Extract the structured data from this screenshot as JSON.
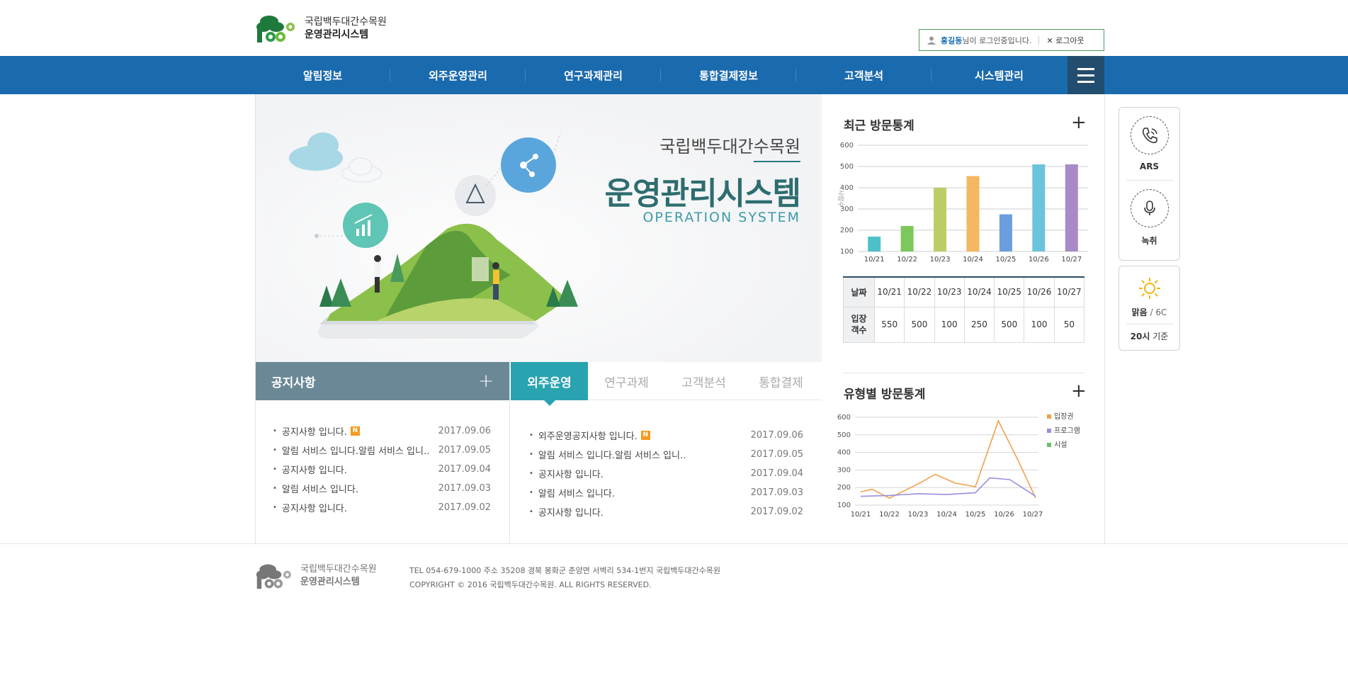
{
  "header": {
    "logo_line1": "국립백두대간수목원",
    "logo_line2": "운영관리시스템",
    "login_user": "홍길동",
    "login_suffix": "님이 로그인중입니다.",
    "logout": "로그아웃"
  },
  "nav": {
    "items": [
      "알림정보",
      "외주운영관리",
      "연구과제관리",
      "통합결제정보",
      "고객분석",
      "시스템관리"
    ]
  },
  "hero": {
    "title1": "국립백두대간수목원",
    "title2": "운영관리시스템",
    "title3": "OPERATION SYSTEM"
  },
  "notice": {
    "title": "공지사항",
    "items": [
      {
        "text": "공지사항 입니다.",
        "date": "2017.09.06",
        "new": true
      },
      {
        "text": "알림 서비스 입니다.알림 서비스 입니…",
        "date": "2017.09.05",
        "new": false
      },
      {
        "text": "공지사항 입니다.",
        "date": "2017.09.04",
        "new": false
      },
      {
        "text": "알림 서비스 입니다.",
        "date": "2017.09.03",
        "new": false
      },
      {
        "text": "공지사항 입니다.",
        "date": "2017.09.02",
        "new": false
      }
    ]
  },
  "tabs": {
    "labels": [
      "외주운영",
      "연구과제",
      "고객분석",
      "통합결제"
    ],
    "items": [
      {
        "text": "외주운영공지사항 입니다.",
        "date": "2017.09.06",
        "new": true
      },
      {
        "text": "알림 서비스 입니다.알림 서비스 입니…",
        "date": "2017.09.05",
        "new": false
      },
      {
        "text": "공지사항 입니다.",
        "date": "2017.09.04",
        "new": false
      },
      {
        "text": "알림 서비스 입니다.",
        "date": "2017.09.03",
        "new": false
      },
      {
        "text": "공지사항 입니다.",
        "date": "2017.09.02",
        "new": false
      }
    ]
  },
  "badge_new": "N",
  "visit_stats": {
    "title": "최근 방문통계",
    "ylabel": "사람수",
    "table_head_date": "날짜",
    "table_head_count": "입장객수",
    "counts": [
      "550",
      "500",
      "100",
      "250",
      "500",
      "100",
      "50"
    ]
  },
  "type_stats": {
    "title": "유형별 방문통계"
  },
  "chart_data": [
    {
      "type": "bar",
      "title": "최근 방문통계",
      "ylabel": "사람수",
      "categories": [
        "10/21",
        "10/22",
        "10/23",
        "10/24",
        "10/25",
        "10/26",
        "10/27"
      ],
      "values": [
        170,
        220,
        400,
        455,
        275,
        510,
        510
      ],
      "colors": [
        "#4fc0c8",
        "#7cc85a",
        "#bccd68",
        "#f5b75f",
        "#6a9ee0",
        "#6cc4dc",
        "#a98ac8"
      ],
      "ylim": [
        100,
        600
      ],
      "yticks": [
        100,
        200,
        300,
        400,
        500,
        600
      ]
    },
    {
      "type": "line",
      "title": "유형별 방문통계",
      "categories": [
        "10/21",
        "10/22",
        "10/23",
        "10/24",
        "10/25",
        "10/26",
        "10/27"
      ],
      "x": [
        0,
        0.5,
        1.5,
        2,
        2.5,
        3.5,
        4.5,
        5.0,
        5.5,
        6.0,
        6.5,
        7
      ],
      "series": [
        {
          "name": "입장권",
          "color": "#f0a04b",
          "points": [
            [
              0,
              175
            ],
            [
              0.4,
              190
            ],
            [
              1,
              140
            ],
            [
              2,
              220
            ],
            [
              2.6,
              275
            ],
            [
              3.3,
              225
            ],
            [
              4,
              205
            ],
            [
              4.8,
              580
            ],
            [
              5.5,
              350
            ],
            [
              6.1,
              140
            ]
          ]
        },
        {
          "name": "프로그램",
          "color": "#9b8fdc",
          "points": [
            [
              0,
              150
            ],
            [
              1,
              155
            ],
            [
              2,
              165
            ],
            [
              3,
              160
            ],
            [
              4,
              170
            ],
            [
              4.5,
              255
            ],
            [
              5.2,
              245
            ],
            [
              6.1,
              150
            ]
          ]
        },
        {
          "name": "시설",
          "color": "#6cc06c",
          "points": []
        }
      ],
      "ylim": [
        100,
        600
      ],
      "yticks": [
        100,
        200,
        300,
        400,
        500,
        600
      ]
    }
  ],
  "side": {
    "ars": "ARS",
    "record": "녹취",
    "weather_state": "맑음",
    "weather_temp": "/ 6C",
    "weather_time": "20시",
    "weather_time_suffix": "기준"
  },
  "footer": {
    "logo_line1": "국립백두대간수목원",
    "logo_line2": "운영관리시스템",
    "info": "TEL 054-679-1000 주소 35208 경북 봉화군 춘양면 서벽리 534-1번지 국립백두대간수목원",
    "copyright": "COPYRIGHT © 2016 국립백두대간수목원. ALL RIGHTS RESERVED."
  },
  "colors": {
    "nav": "#1a6aae",
    "notice_head": "#6b8897",
    "tab_active": "#2aa3b0"
  }
}
